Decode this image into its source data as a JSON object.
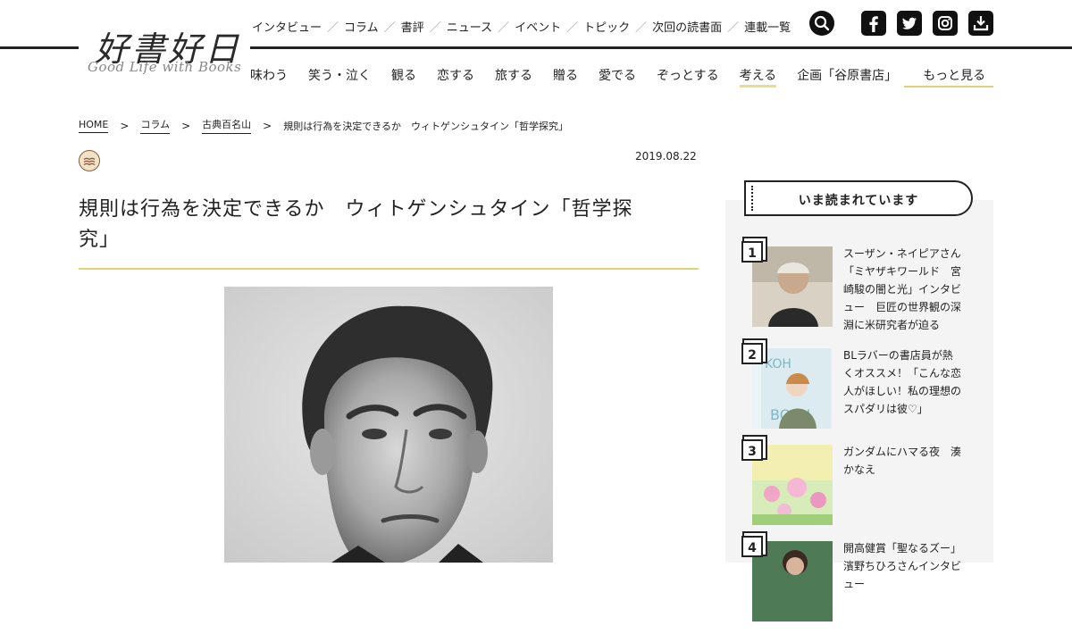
{
  "site": {
    "logo_jp": "好書好日",
    "logo_en": "Good Life with Books"
  },
  "top_nav": [
    "インタビュー",
    "コラム",
    "書評",
    "ニュース",
    "イベント",
    "トピック",
    "次回の読書面",
    "連載一覧"
  ],
  "social_icons": [
    "search-icon",
    "facebook-icon",
    "twitter-icon",
    "instagram-icon",
    "download-icon"
  ],
  "main_nav": [
    "味わう",
    "笑う・泣く",
    "観る",
    "恋する",
    "旅する",
    "贈る",
    "愛でる",
    "ぞっとする",
    "考える",
    "企画「谷原書店」",
    "もっと見る"
  ],
  "breadcrumb": {
    "home": "HOME",
    "column": "コラム",
    "series": "古典百名山",
    "current": "規則は行為を決定できるか　ウィトゲンシュタイン「哲学探究」"
  },
  "article": {
    "date": "2019.08.22",
    "title_line1": "規則は行為を決定できるか　ウィトゲンシュタイン「哲学探",
    "title_line2": "究」"
  },
  "sidebar": {
    "heading": "いま読まれています",
    "ranking": [
      {
        "rank": "1",
        "text": "スーザン・ネイピアさん「ミヤザキワールド　宮崎駿の闇と光」インタビュー　巨匠の世界観の深淵に米研究者が迫る"
      },
      {
        "rank": "2",
        "text": "BLラバーの書店員が熱くオススメ！「こんな恋人がほしい！私の理想のスパダリは彼♡」"
      },
      {
        "rank": "3",
        "text": "ガンダムにハマる夜　湊かなえ"
      },
      {
        "rank": "4",
        "text": "開高健賞「聖なるズー」濱野ちひろさんインタビュー"
      }
    ]
  },
  "colors": {
    "accent_yellow": "#e0d07a",
    "text": "#222222",
    "sidebar_bg": "#f4f4f4"
  }
}
